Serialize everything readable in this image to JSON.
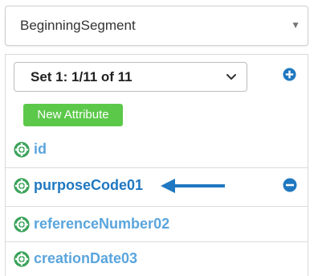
{
  "segment_select": {
    "value": "BeginningSegment"
  },
  "set_select": {
    "value": "Set 1: 1/11 of 11"
  },
  "new_attribute_button": {
    "label": "New Attribute"
  },
  "attributes": [
    {
      "label": "id"
    },
    {
      "label": "purposeCode01"
    },
    {
      "label": "referenceNumber02"
    },
    {
      "label": "creationDate03"
    }
  ],
  "icons": {
    "add": "plus-circle-icon",
    "remove": "minus-circle-icon",
    "attribute": "life-ring-icon",
    "arrow": "left-arrow"
  },
  "colors": {
    "link": "#5aa5dd",
    "active_link": "#1f78c1",
    "button_green": "#5cc84a",
    "icon_blue": "#1f78c1",
    "icon_green": "#3aa35a"
  }
}
